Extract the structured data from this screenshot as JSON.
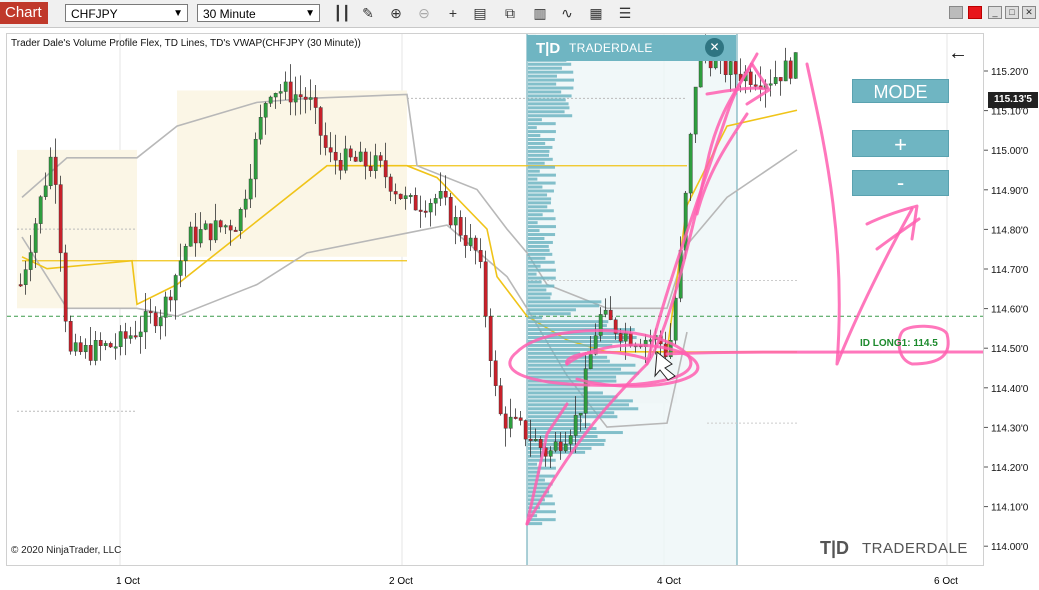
{
  "toolbar": {
    "chart_tab_label": "Chart",
    "instrument": "CHFJPY",
    "timeframe": "30 Minute",
    "icons": [
      "bars-icon",
      "pencil-icon",
      "zoom-in-icon",
      "zoom-out-icon",
      "crosshair-icon",
      "data-box-icon",
      "strategy-icon",
      "indicator-icon",
      "drawing-tools-icon",
      "properties-icon"
    ]
  },
  "chart": {
    "title": "Trader Dale's Volume Profile Flex, TD Lines, TD's VWAP(CHFJPY (30 Minute))",
    "copyright": "© 2020 NinjaTrader, LLC",
    "brand": "TRADERDALE",
    "vp_header_brand": "TRADERDALE",
    "id_long_label": "ID LONG1: 114.5",
    "current_price": "115.13'5"
  },
  "buttons": {
    "mode": "MODE",
    "plus": "+",
    "minus": "-"
  },
  "price_axis": [
    "115.20'0",
    "115.10'0",
    "115.00'0",
    "114.90'0",
    "114.80'0",
    "114.70'0",
    "114.60'0",
    "114.50'0",
    "114.40'0",
    "114.30'0",
    "114.20'0",
    "114.10'0",
    "114.00'0"
  ],
  "time_axis": [
    "1 Oct",
    "2 Oct",
    "4 Oct",
    "6 Oct"
  ],
  "colors": {
    "up_candle": "#2e9e3e",
    "down_candle": "#c8202a",
    "vwap": "#f0c419",
    "bands": "#b8b8b8",
    "volume_profile": "#6fb5c2",
    "annotation": "#ff5fb0",
    "price_tag": "#222222"
  }
}
